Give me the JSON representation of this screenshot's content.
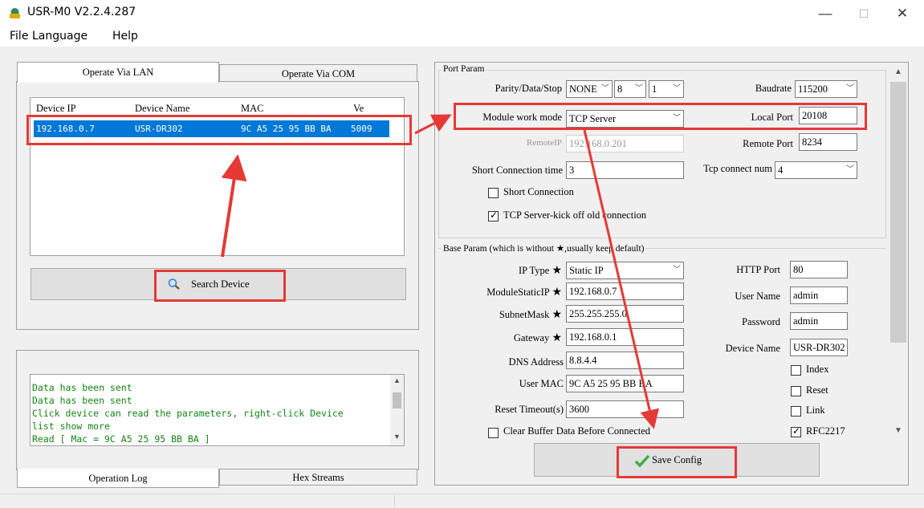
{
  "window": {
    "title": "USR-M0 V2.2.4.287",
    "minimize": "—",
    "maximize": "☐",
    "close": "✕"
  },
  "menu": [
    "File",
    "Language",
    "Help"
  ],
  "left": {
    "tabs": [
      "Operate Via LAN",
      "Operate Via COM"
    ],
    "table": {
      "headers": [
        "Device IP",
        "Device Name",
        "MAC",
        "Ve"
      ],
      "row": [
        "192.168.0.7",
        "USR-DR302",
        "9C A5 25 95 BB BA",
        "5009"
      ]
    },
    "search_label": "Search Device",
    "log_lines": [
      " Data has been sent",
      " Data has been sent",
      "Click device can read the parameters, right-click Device",
      "list show more",
      "Read [ Mac = 9C A5 25 95 BB BA ]"
    ],
    "bottom_tabs": [
      "Operation Log",
      "Hex Streams"
    ]
  },
  "port": {
    "section": "Port Param",
    "parity_label": "Parity/Data/Stop",
    "parity": "NONE",
    "data": "8",
    "stop": "1",
    "baud_label": "Baudrate",
    "baud": "115200",
    "mode_label": "Module work mode",
    "mode": "TCP Server",
    "local_port_label": "Local Port",
    "local_port": "20108",
    "remote_ip_label": "RemoteIP",
    "remote_ip": "192.168.0.201",
    "remote_port_label": "Remote Port",
    "remote_port": "8234",
    "short_time_label": "Short Connection time",
    "short_time": "3",
    "tcp_num_label": "Tcp connect num",
    "tcp_num": "4",
    "short_conn_label": "Short Connection",
    "short_conn": false,
    "kick_label": "TCP Server-kick off old connection",
    "kick": true
  },
  "base": {
    "section": "Base Param (which is without ★,usually keep default)",
    "star": "★",
    "ip_type_label": "IP Type",
    "ip_type": "Static IP",
    "static_ip_label": "ModuleStaticIP",
    "static_ip": "192.168.0.7",
    "subnet_label": "SubnetMask",
    "subnet": "255.255.255.0",
    "gateway_label": "Gateway",
    "gateway": "192.168.0.1",
    "dns_label": "DNS Address",
    "dns": "8.8.4.4",
    "mac_label": "User MAC",
    "mac": "9C A5 25 95 BB BA",
    "reset_label": "Reset Timeout(s)",
    "reset": "3600",
    "clear_label": "Clear Buffer Data Before Connected",
    "http_label": "HTTP Port",
    "http": "80",
    "user_label": "User Name",
    "user": "admin",
    "pass_label": "Password",
    "pass": "admin",
    "dev_label": "Device Name",
    "dev": "USR-DR302",
    "checks": [
      {
        "label": "Index",
        "on": false
      },
      {
        "label": "Reset",
        "on": false
      },
      {
        "label": "Link",
        "on": false
      },
      {
        "label": "RFC2217",
        "on": true
      }
    ]
  },
  "save_label": "Save Config",
  "colors": {
    "selection": "#0078d7",
    "highlight": "#e53935",
    "log_text": "#138613",
    "save_check": "#3cb043"
  }
}
